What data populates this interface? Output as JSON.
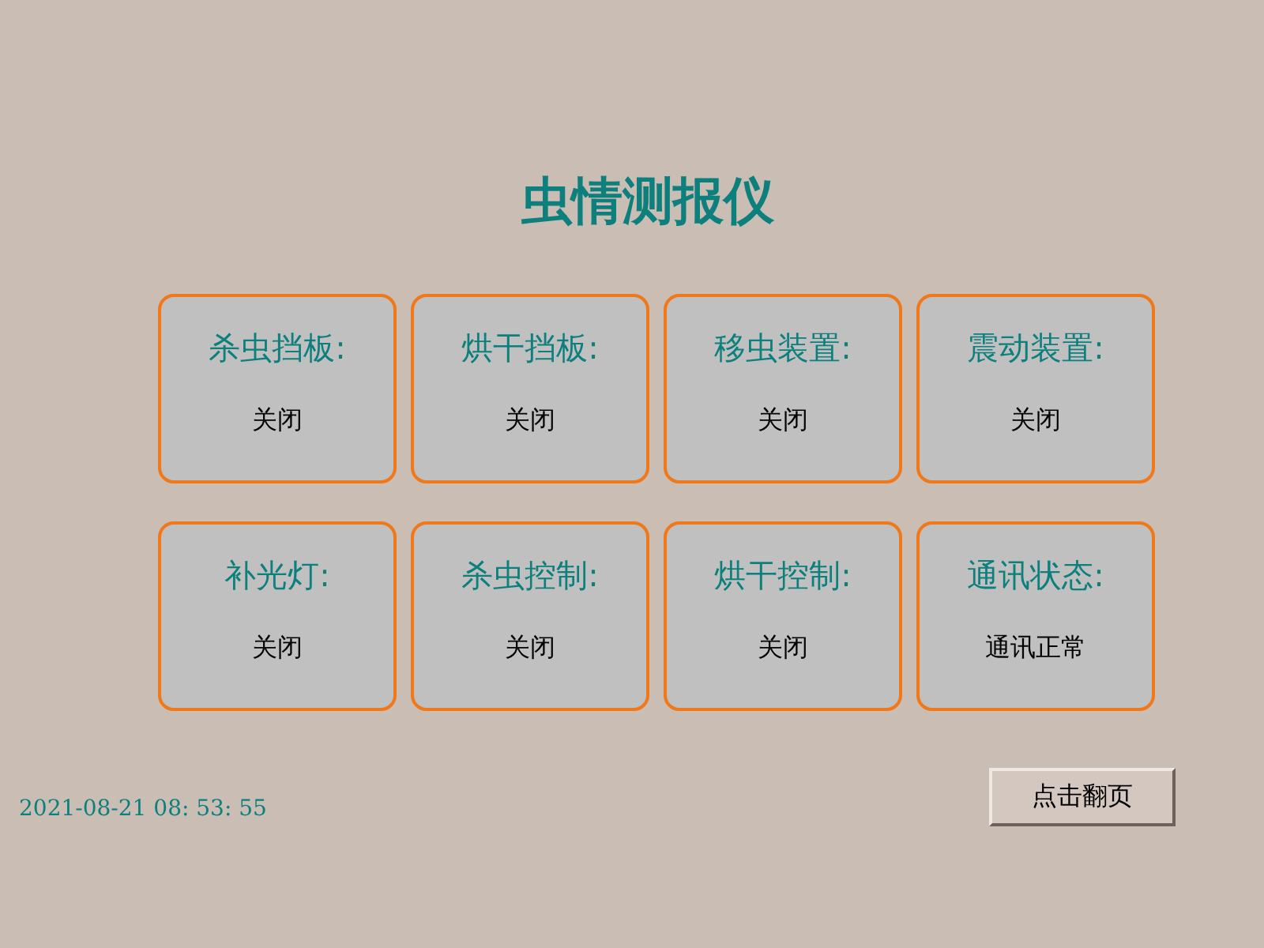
{
  "title": "虫情测报仪",
  "cards": [
    {
      "label": "杀虫挡板:",
      "value": "关闭"
    },
    {
      "label": "烘干挡板:",
      "value": "关闭"
    },
    {
      "label": "移虫装置:",
      "value": "关闭"
    },
    {
      "label": "震动装置:",
      "value": "关闭"
    },
    {
      "label": "补光灯:",
      "value": "关闭"
    },
    {
      "label": "杀虫控制:",
      "value": "关闭"
    },
    {
      "label": "烘干控制:",
      "value": "关闭"
    },
    {
      "label": "通讯状态:",
      "value": "通讯正常"
    }
  ],
  "timestamp": "2021-08-21 08: 53: 55",
  "button": {
    "label": "点击翻页"
  }
}
